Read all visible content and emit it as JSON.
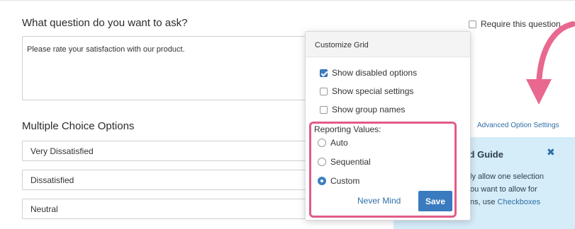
{
  "question": {
    "heading": "What question do you want to ask?",
    "text": "Please rate your satisfaction with our product.",
    "require_label": "Require this question"
  },
  "choices": {
    "heading": "Multiple Choice Options",
    "options": [
      "Very Dissatisfied",
      "Dissatisfied",
      "Neutral"
    ],
    "advanced_link": "Advanced Option Settings"
  },
  "guide": {
    "title": "ted Guide",
    "close_glyph": "✖",
    "line1": "ly allow one selection",
    "line2": "ou want to allow for",
    "line3_prefix": "ns, use ",
    "line3_link": "Checkboxes"
  },
  "popover": {
    "title": "Customize Grid",
    "checkboxes": [
      {
        "label": "Show disabled options",
        "checked": true
      },
      {
        "label": "Show special settings",
        "checked": false
      },
      {
        "label": "Show group names",
        "checked": false
      }
    ],
    "reporting_label": "Reporting Values:",
    "radios": [
      {
        "label": "Auto",
        "checked": false
      },
      {
        "label": "Sequential",
        "checked": false
      },
      {
        "label": "Custom",
        "checked": true
      }
    ],
    "cancel_label": "Never Mind",
    "save_label": "Save"
  },
  "colors": {
    "accent": "#3a7bbf",
    "highlight": "#e15c88",
    "guide_bg": "#d5ecf9"
  }
}
